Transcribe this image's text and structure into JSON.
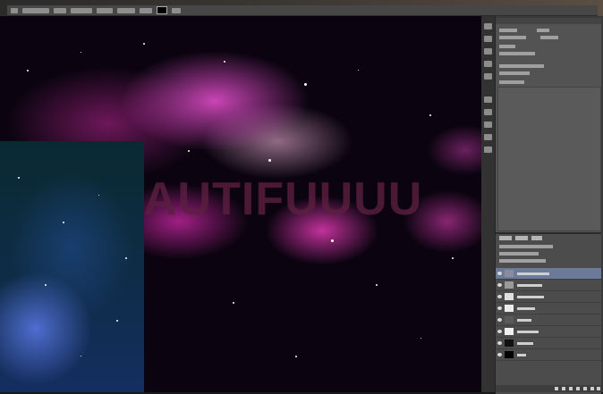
{
  "canvas": {
    "text": "AUTIFUUUU"
  },
  "colors": {
    "background": "#1a1a1a",
    "panel": "#535353",
    "panel_dark": "#3a3a3a",
    "selected_layer": "#6b7a99",
    "nebula_pink": "#e050d0",
    "space_blue": "#142e60"
  },
  "icons": [
    "move-tool-icon",
    "eye-icon",
    "layer-thumbnail-icon",
    "new-layer-icon",
    "delete-icon"
  ]
}
